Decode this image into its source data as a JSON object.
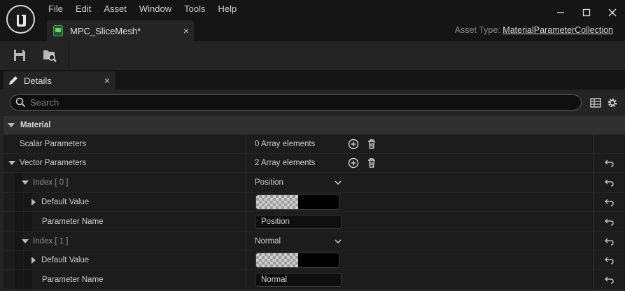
{
  "app": {
    "menu": [
      "File",
      "Edit",
      "Asset",
      "Window",
      "Tools",
      "Help"
    ],
    "window_controls": [
      "minimize-icon",
      "maximize-icon",
      "close-icon"
    ]
  },
  "document_tab": {
    "label": "MPC_SliceMesh*",
    "close": "×"
  },
  "asset_type": {
    "label": "Asset Type:",
    "value": "MaterialParameterCollection"
  },
  "toolbar": {
    "buttons": [
      "save-icon",
      "browse-icon"
    ]
  },
  "details_tab": {
    "label": "Details",
    "close": "×"
  },
  "search": {
    "placeholder": "Search",
    "value": ""
  },
  "category": {
    "label": "Material"
  },
  "rows": {
    "scalar": {
      "name": "Scalar Parameters",
      "value": "0 Array elements"
    },
    "vector": {
      "name": "Vector Parameters",
      "value": "2 Array elements"
    },
    "index0": {
      "name": "Index [ 0 ]",
      "value": "Position"
    },
    "index0_default": {
      "name": "Default Value"
    },
    "index0_param": {
      "name": "Parameter Name",
      "value": "Position"
    },
    "index1": {
      "name": "Index [ 1 ]",
      "value": "Normal"
    },
    "index1_default": {
      "name": "Default Value"
    },
    "index1_param": {
      "name": "Parameter Name",
      "value": "Normal"
    }
  },
  "colors": {
    "background": "#151515",
    "panel": "#242424",
    "row": "#1c1c1c",
    "category": "#303030"
  }
}
